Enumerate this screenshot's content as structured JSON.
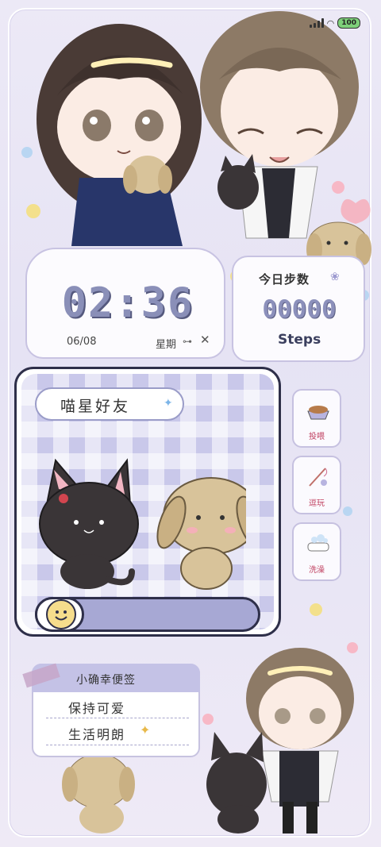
{
  "status_bar": {
    "battery": "100"
  },
  "clock": {
    "time": "02:36",
    "date": "06/08",
    "weekday": "星期"
  },
  "steps": {
    "title": "今日步数",
    "count": "00000",
    "label": "Steps"
  },
  "pet": {
    "title": "喵星好友",
    "progress": 0.22
  },
  "actions": [
    {
      "label": "投喂",
      "icon": "pet-food-bowl-icon"
    },
    {
      "label": "逗玩",
      "icon": "cat-teaser-wand-icon"
    },
    {
      "label": "洗澡",
      "icon": "bathtub-icon"
    }
  ],
  "note": {
    "title": "小确幸便签",
    "lines": [
      "保持可爱",
      "生活明朗"
    ]
  },
  "colors": {
    "accent": "#8a8fb8",
    "outline": "#2e2f49",
    "lavender": "#c9c8ea",
    "pink": "#f2a0b4"
  }
}
